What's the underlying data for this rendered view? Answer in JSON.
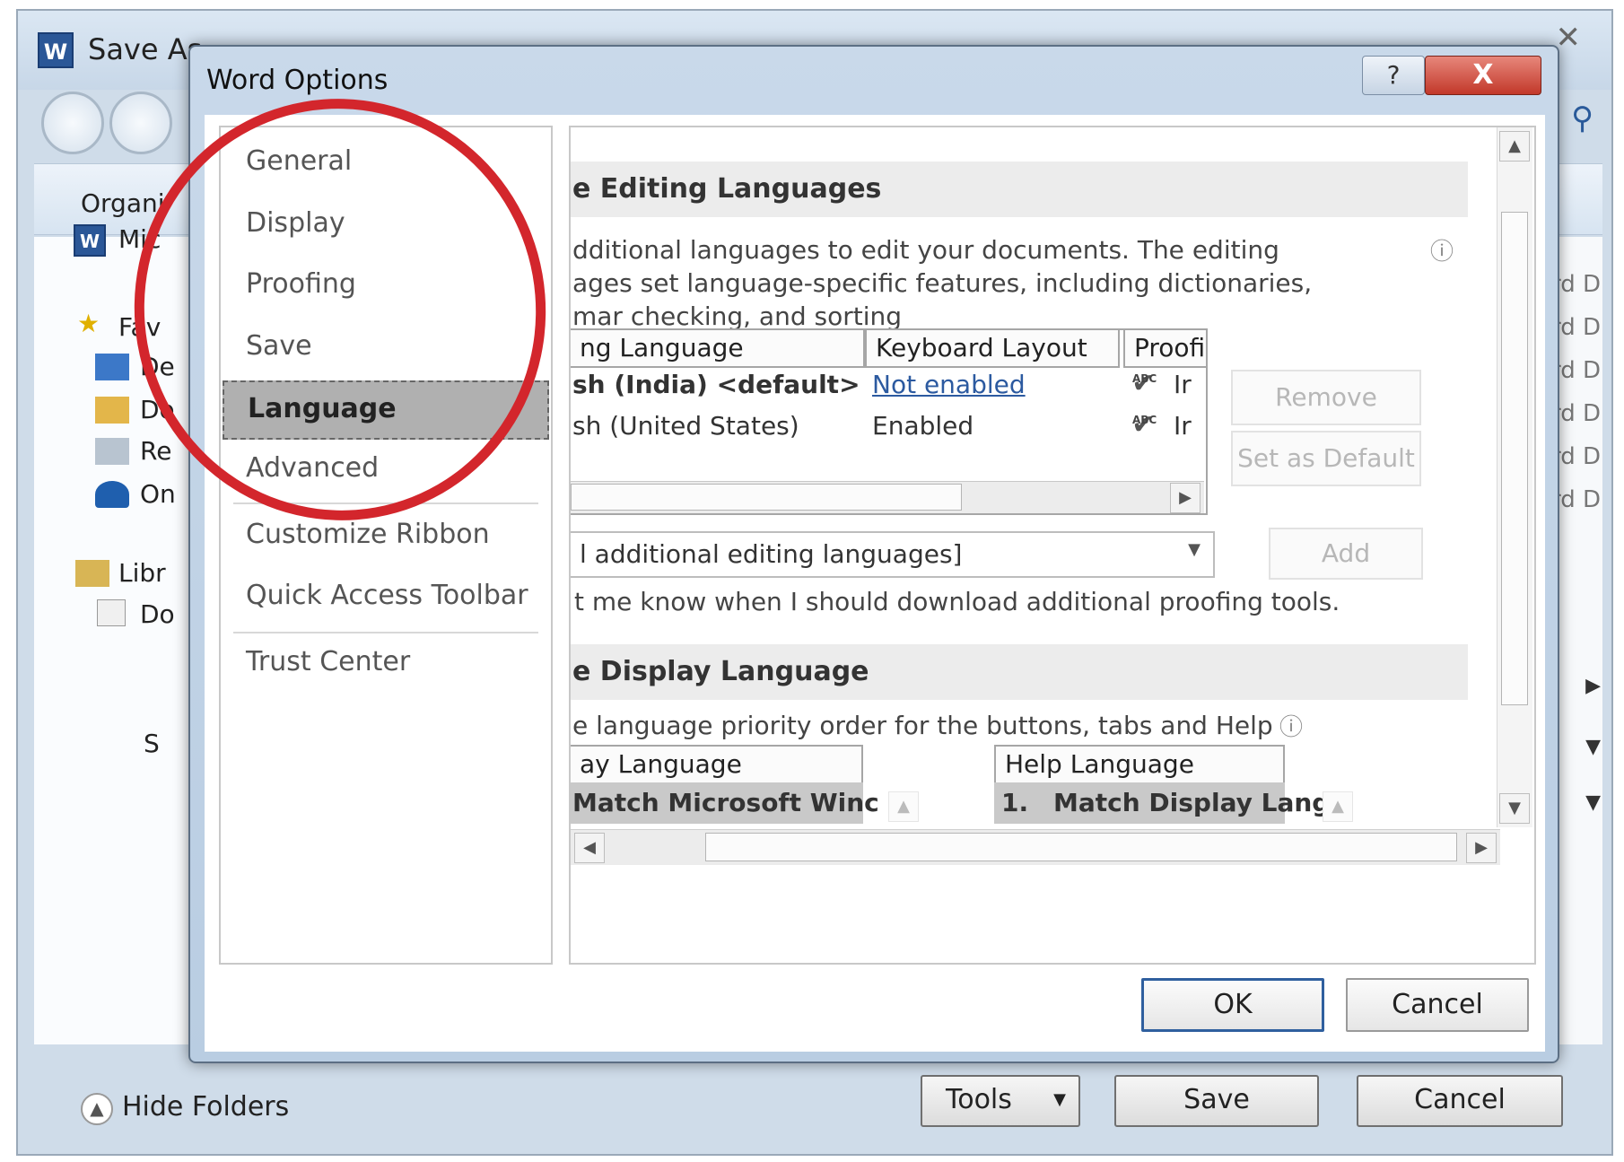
{
  "save_as": {
    "title": "Save As",
    "toolbar_label": "Organi",
    "left_items": [
      "Mic",
      "Fav",
      "De",
      "Do",
      "Re",
      "On",
      "Libr",
      "Do"
    ],
    "right_column_text": [
      "rd D",
      "rd D",
      "rd D",
      "rd D",
      "rd D",
      "rd D"
    ],
    "file_name_label": "S",
    "hide_folders": "Hide Folders",
    "tools_label": "Tools",
    "save_label": "Save",
    "cancel_label": "Cancel"
  },
  "dialog": {
    "title": "Word Options",
    "help_glyph": "?",
    "close_glyph": "X",
    "nav": {
      "items": [
        "General",
        "Display",
        "Proofing",
        "Save",
        "Language",
        "Advanced",
        "Customize Ribbon",
        "Quick Access Toolbar",
        "Trust Center"
      ],
      "active": "Language"
    },
    "editing": {
      "heading": "e Editing Languages",
      "desc_line1": "dditional languages to edit your documents. The editing",
      "desc_line2": "ages set language-specific features, including dictionaries,",
      "desc_line3": "mar checking, and sorting",
      "columns": [
        "ng Language",
        "Keyboard Layout",
        "Proofi"
      ],
      "rows": [
        {
          "language": "sh (India) <default>",
          "keyboard": "Not enabled",
          "proofing": "Ir"
        },
        {
          "language": "sh (United States)",
          "keyboard": "Enabled",
          "proofing": "Ir"
        }
      ],
      "remove_label": "Remove",
      "set_default_label": "Set as Default",
      "dropdown_value": "l additional editing languages]",
      "add_label": "Add",
      "notify_text": "t me know when I should download additional proofing tools."
    },
    "display": {
      "heading": "e Display Language",
      "desc": "e language priority order for the buttons, tabs and Help",
      "display_col": "ay Language",
      "display_row": "Match Microsoft Winc",
      "help_col": "Help Language",
      "help_row_num": "1.",
      "help_row": "Match Display Langu"
    },
    "ok_label": "OK",
    "cancel_label": "Cancel"
  },
  "colors": {
    "annotation": "#d3262c",
    "nav_selected": "#b0b0b0",
    "link": "#2c5aa0"
  }
}
